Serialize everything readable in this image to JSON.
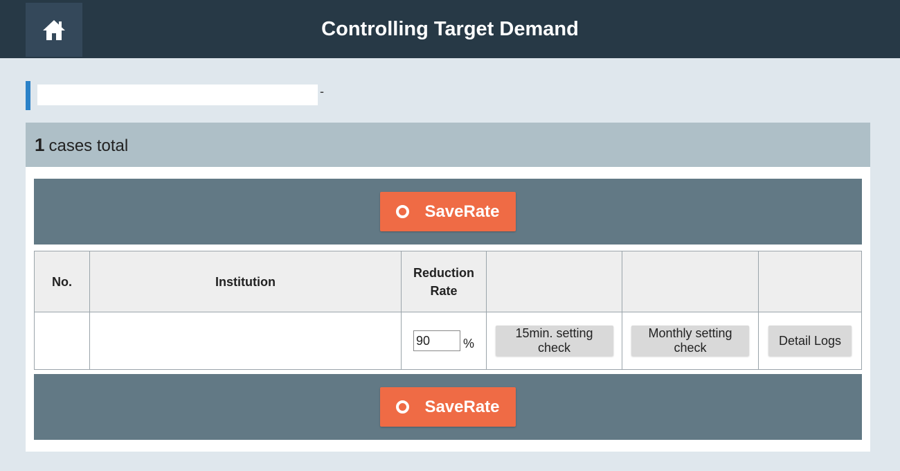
{
  "header": {
    "title": "Controlling Target Demand",
    "home_icon": "home-icon"
  },
  "summary": {
    "count": "1",
    "count_label": "cases total",
    "name_suffix": "-"
  },
  "actions": {
    "save_label": "SaveRate"
  },
  "table": {
    "headers": [
      "No.",
      "Institution",
      "Reduction Rate",
      "",
      "",
      ""
    ],
    "rows": [
      {
        "no": "",
        "institution": "",
        "rate_value": "90",
        "rate_unit": "%",
        "check_15min": "15min. setting check",
        "check_monthly": "Monthly setting check",
        "detail_logs": "Detail Logs"
      }
    ]
  },
  "colors": {
    "header_bg": "#273946",
    "accent": "#2b82c8",
    "save_button": "#ef6b45",
    "band": "#627985"
  }
}
